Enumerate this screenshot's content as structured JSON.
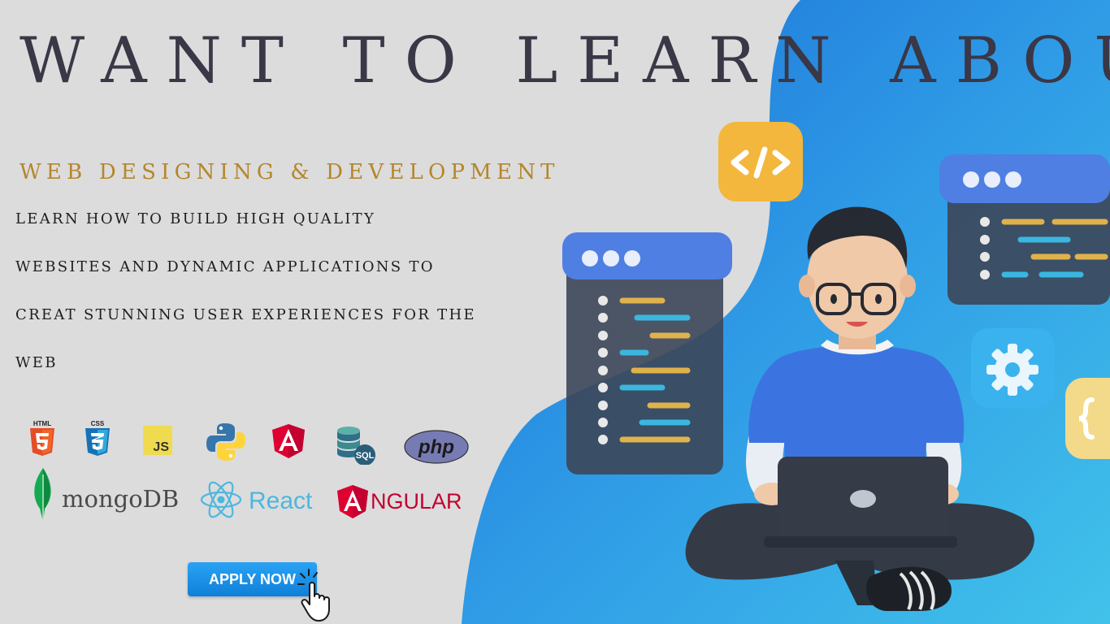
{
  "headline": "WANT TO LEARN ABOUT",
  "subheading": "WEB DESIGNING & DEVELOPMENT",
  "description_lines": [
    "LEARN HOW TO BUILD  HIGH QUALITY",
    "WEBSITES AND DYNAMIC APPLICATIONS TO",
    "CREAT STUNNING USER EXPERIENCES FOR THE",
    "WEB"
  ],
  "tech_logos": {
    "html5": "HTML",
    "css3": "CSS",
    "javascript": "JS",
    "sql": "SQL",
    "php": "php",
    "mongodb": "mongoDB",
    "react": "React",
    "angular": "NGULAR"
  },
  "apply_button_label": "APPLY NOW",
  "colors": {
    "background_gray": "#dcdcdc",
    "blue_panel": "#2a8fe0",
    "headline": "#3a3746",
    "subheading_gold": "#b5862c",
    "button_blue": "#1a8fe8"
  },
  "icons": [
    "code-tag-icon",
    "gear-icon",
    "braces-icon",
    "pointer-hand-icon",
    "html5-icon",
    "css3-icon",
    "js-icon",
    "python-icon",
    "angular-icon",
    "database-icon",
    "mongodb-leaf-icon",
    "react-atom-icon"
  ]
}
